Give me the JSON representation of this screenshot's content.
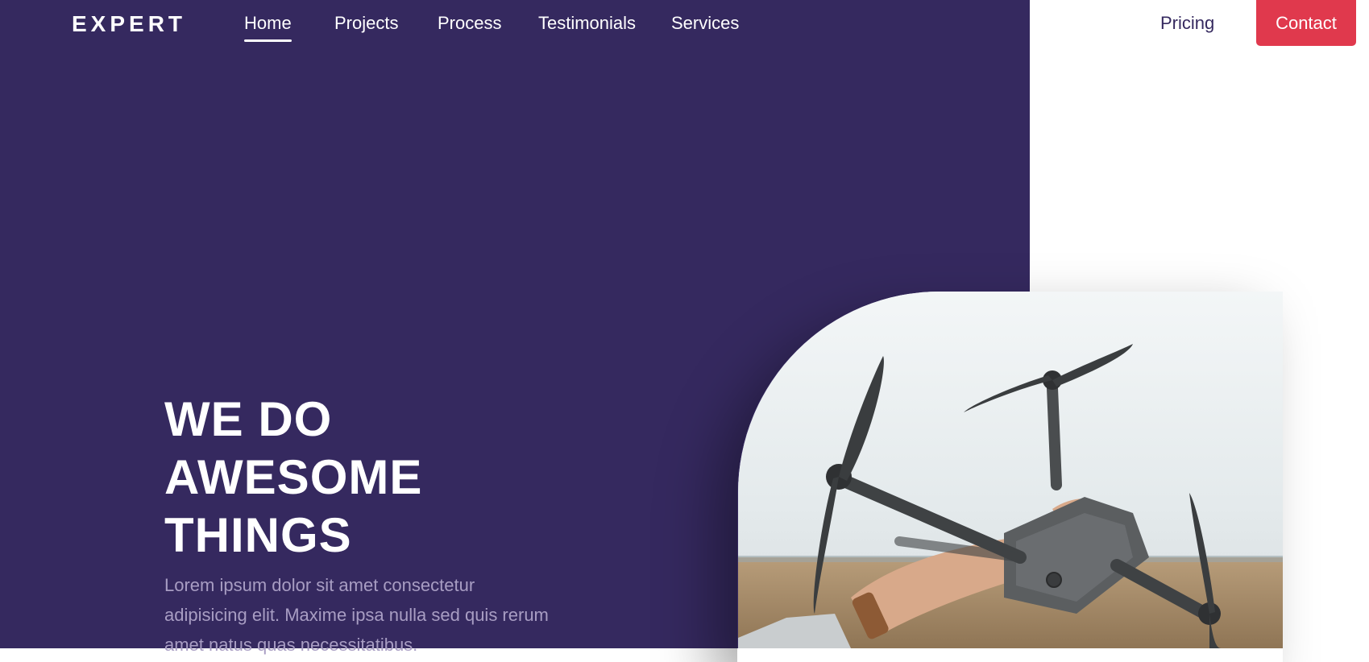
{
  "brand": {
    "logo_text": "EXPERT"
  },
  "nav": {
    "links": [
      {
        "label": "Home",
        "active": true
      },
      {
        "label": "Projects"
      },
      {
        "label": "Process"
      },
      {
        "label": "Testimonials"
      },
      {
        "label": "Services"
      },
      {
        "label": "Pricing"
      }
    ],
    "contact_label": "Contact"
  },
  "hero": {
    "title_lines": [
      "WE DO",
      "AWESOME",
      "THINGS"
    ],
    "text": "Lorem ipsum dolor sit amet consectetur adipisicing elit. Maxime ipsa nulla sed quis rerum amet natus quas necessitatibus.",
    "image_subject": "drone-photo"
  },
  "colors": {
    "hero_background": "#35295f",
    "accent": "#e0394d",
    "hero_text_muted": "#a89dc3",
    "page_background": "#ffffff"
  }
}
